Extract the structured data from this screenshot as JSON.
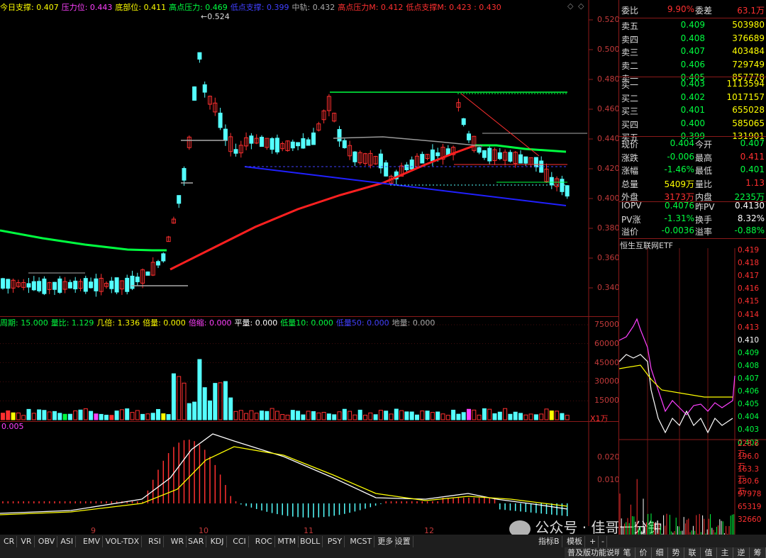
{
  "main_header": [
    {
      "label": "今日支撑",
      "value": "0.407",
      "color": "#ffff00"
    },
    {
      "label": "压力位",
      "value": "0.443",
      "color": "#ff40ff"
    },
    {
      "label": "底部位",
      "value": "0.411",
      "color": "#ffff00"
    },
    {
      "label": "高点压力",
      "value": "0.469",
      "color": "#00ff40"
    },
    {
      "label": "低点支撑",
      "value": "0.399",
      "color": "#4040ff"
    },
    {
      "label": "中轨",
      "value": "0.432",
      "color": "#aaaaaa"
    },
    {
      "label": "高点压力M",
      "value": "0.412",
      "color": "#ff3030"
    },
    {
      "label": "低点支撑M",
      "value": "0.423 : 0.430",
      "color": "#ff3030"
    }
  ],
  "price_axis": [
    "0.520",
    "0.500",
    "0.480",
    "0.460",
    "0.440",
    "0.420",
    "0.400",
    "0.380",
    "0.360",
    "0.340"
  ],
  "peak_label": "0.524",
  "vol_header": [
    {
      "label": "周期",
      "value": "15.000",
      "color": "#00ff40"
    },
    {
      "label": "量比",
      "value": "1.129",
      "color": "#00ff40"
    },
    {
      "label": "几倍",
      "value": "1.336",
      "color": "#ffff00"
    },
    {
      "label": "倍量",
      "value": "0.000",
      "color": "#ffff00"
    },
    {
      "label": "倍缩",
      "value": "0.000",
      "color": "#ff40ff"
    },
    {
      "label": "平量",
      "value": "0.000",
      "color": "#ffffff"
    },
    {
      "label": "低量10",
      "value": "0.000",
      "color": "#00ff40"
    },
    {
      "label": "低量50",
      "value": "0.000",
      "color": "#4040ff"
    },
    {
      "label": "地量",
      "value": "0.000",
      "color": "#aaaaaa"
    }
  ],
  "vol_axis": [
    "75000",
    "60000",
    "45000",
    "30000",
    "15000"
  ],
  "vol_unit": "X1万",
  "macd_header": "0.005",
  "macd_axis": [
    "0.020",
    "0.010"
  ],
  "x_axis": [
    "9",
    "10",
    "11",
    "12"
  ],
  "indicator_tabs": [
    "CR",
    "VR",
    "OBV",
    "ASI",
    "EMV",
    "VOL-TDX",
    "RSI",
    "WR",
    "SAR",
    "KDJ",
    "CCI",
    "ROC",
    "MTM",
    "BOLL",
    "PSY",
    "MCST",
    "更多",
    "设置"
  ],
  "right_tabs": [
    "指标B",
    "模板",
    "+",
    "-"
  ],
  "bottom_tabs": [
    "普及版功能说明",
    "笔",
    "价",
    "细",
    "势",
    "联",
    "值",
    "主",
    "逆",
    "筹"
  ],
  "order_book": {
    "weibi": {
      "label": "委比",
      "value": "9.90%",
      "label2": "委差",
      "value2": "63.1万"
    },
    "sells": [
      {
        "label": "卖五",
        "price": "0.409",
        "vol": "503980"
      },
      {
        "label": "卖四",
        "price": "0.408",
        "vol": "376689"
      },
      {
        "label": "卖三",
        "price": "0.407",
        "vol": "403484"
      },
      {
        "label": "卖二",
        "price": "0.406",
        "vol": "729749"
      },
      {
        "label": "卖一",
        "price": "0.405",
        "vol": "857778"
      }
    ],
    "buys": [
      {
        "label": "买一",
        "price": "0.403",
        "vol": "1113594"
      },
      {
        "label": "买二",
        "price": "0.402",
        "vol": "1017157"
      },
      {
        "label": "买三",
        "price": "0.401",
        "vol": "655028"
      },
      {
        "label": "买四",
        "price": "0.400",
        "vol": "585065"
      },
      {
        "label": "买五",
        "price": "0.399",
        "vol": "131901"
      }
    ]
  },
  "quote": [
    {
      "l1": "现价",
      "v1": "0.404",
      "c1": "#00ff40",
      "l2": "今开",
      "v2": "0.407",
      "c2": "#00ff40"
    },
    {
      "l1": "涨跌",
      "v1": "-0.006",
      "c1": "#00ff40",
      "l2": "最高",
      "v2": "0.411",
      "c2": "#ff3030"
    },
    {
      "l1": "涨幅",
      "v1": "-1.46%",
      "c1": "#00ff40",
      "l2": "最低",
      "v2": "0.401",
      "c2": "#00ff40"
    },
    {
      "l1": "总量",
      "v1": "5409万",
      "c1": "#ffff00",
      "l2": "量比",
      "v2": "1.13",
      "c2": "#ff3030"
    },
    {
      "l1": "外盘",
      "v1": "3173万",
      "c1": "#ff3030",
      "l2": "内盘",
      "v2": "2235万",
      "c2": "#00ff40"
    }
  ],
  "iopv": [
    {
      "l1": "IOPV",
      "v1": "0.4076",
      "c1": "#00ff40",
      "l2": "昨PV",
      "v2": "0.4130",
      "c2": "#ffffff"
    },
    {
      "l1": "PV涨",
      "v1": "-1.31%",
      "c1": "#00ff40",
      "l2": "换手",
      "v2": "8.32%",
      "c2": "#ffffff"
    },
    {
      "l1": "溢价",
      "v1": "-0.0036",
      "c1": "#00ff40",
      "l2": "溢率",
      "v2": "-0.88%",
      "c2": "#00ff40"
    }
  ],
  "fund_name": "恒生互联网ETF",
  "mini_price_axis": [
    "0.419",
    "0.418",
    "0.417",
    "0.416",
    "0.415",
    "0.414",
    "0.413",
    "0.410",
    "0.409",
    "0.408",
    "0.407",
    "0.406",
    "0.405",
    "0.404",
    "0.403",
    "0.402"
  ],
  "mini_vol_axis": [
    "228.6万",
    "196.0万",
    "163.3万",
    "130.6万",
    "97978",
    "65319",
    "32660"
  ],
  "watermark": "公众号 · 佳哥一分钟",
  "colors": {
    "up": "#ff3030",
    "down": "#54ffff",
    "ma_green": "#00ff40",
    "ma_red": "#ff2020",
    "support_blue": "#2020ff",
    "grid": "#8b1a1a"
  }
}
